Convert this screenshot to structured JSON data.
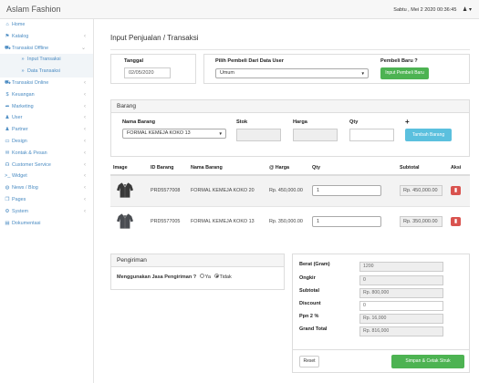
{
  "app": {
    "brand": "Aslam Fashion",
    "datetime": "Sabtu , Mei 2 2020 00:36:45",
    "user_icon": "user-icon",
    "user_caret": "▾"
  },
  "sidebar": {
    "items": [
      {
        "icon": "home-icon",
        "glyph": "⌂",
        "label": "Home",
        "chevron": ""
      },
      {
        "icon": "tag-icon",
        "glyph": "⚑",
        "label": "Katalog",
        "chevron": "‹"
      },
      {
        "icon": "cart-icon",
        "glyph": "⛟",
        "label": "Transaksi Offline",
        "chevron": "⌄"
      },
      {
        "icon": "",
        "glyph": "»",
        "label": "Input Transaksi",
        "chevron": "",
        "sub": true
      },
      {
        "icon": "",
        "glyph": "»",
        "label": "Data Transaksi",
        "chevron": "",
        "sub": true
      },
      {
        "icon": "cart-icon",
        "glyph": "⛟",
        "label": "Transaksi Online",
        "chevron": "‹"
      },
      {
        "icon": "dollar-icon",
        "glyph": "$",
        "label": "Keuangan",
        "chevron": "‹"
      },
      {
        "icon": "share-icon",
        "glyph": "➦",
        "label": "Marketing",
        "chevron": "‹"
      },
      {
        "icon": "user-icon",
        "glyph": "♟",
        "label": "User",
        "chevron": "‹"
      },
      {
        "icon": "users-icon",
        "glyph": "♟",
        "label": "Partner",
        "chevron": "‹"
      },
      {
        "icon": "desktop-icon",
        "glyph": "▭",
        "label": "Design",
        "chevron": "‹"
      },
      {
        "icon": "envelope-icon",
        "glyph": "✉",
        "label": "Kontak & Pesan",
        "chevron": "‹"
      },
      {
        "icon": "headset-icon",
        "glyph": "☊",
        "label": "Customer Service",
        "chevron": "‹"
      },
      {
        "icon": "terminal-icon",
        "glyph": ">_",
        "label": "Widget",
        "chevron": "‹"
      },
      {
        "icon": "globe-icon",
        "glyph": "◍",
        "label": "News / Blog",
        "chevron": "‹"
      },
      {
        "icon": "copy-icon",
        "glyph": "❐",
        "label": "Pages",
        "chevron": "‹"
      },
      {
        "icon": "gears-icon",
        "glyph": "⚙",
        "label": "System",
        "chevron": "‹"
      },
      {
        "icon": "book-icon",
        "glyph": "▤",
        "label": "Dokumentasi",
        "chevron": ""
      }
    ]
  },
  "page": {
    "title": "Input Penjualan / Transaksi"
  },
  "header_panel": {
    "tanggal_label": "Tanggal",
    "tanggal_value": "02/05/2020",
    "pembeli_label": "Pilih Pembeli Dari Data User",
    "pembeli_value": "Umum",
    "baru_label": "Pembeli Baru ?",
    "baru_button": "Input Pembeli Baru"
  },
  "barang_panel": {
    "title": "Barang",
    "nama_label": "Nama Barang",
    "nama_value": "FORMAL KEMEJA KOKO 13",
    "stok_label": "Stok",
    "harga_label": "Harga",
    "qty_label": "Qty",
    "plus_label": "+",
    "tambah_button": "Tambah Barang"
  },
  "table": {
    "headers": [
      "Image",
      "ID Barang",
      "Nama Barang",
      "@ Harga",
      "Qty",
      "Subtotal",
      "Aksi"
    ],
    "rows": [
      {
        "id": "PRD5577008",
        "nama": "FORMAL KEMEJA KOKO 20",
        "harga": "Rp. 450,000.00",
        "qty": "1",
        "subtotal": "Rp. 450,000.00",
        "shirt": "dark"
      },
      {
        "id": "PRD5577005",
        "nama": "FORMAL KEMEJA KOKO 13",
        "harga": "Rp. 350,000.00",
        "qty": "1",
        "subtotal": "Rp. 350,000.00",
        "shirt": "grey"
      }
    ]
  },
  "pengiriman": {
    "title": "Pengiriman",
    "question": "Menggunakan Jasa Pengiriman ?",
    "opt_ya": "Ya",
    "opt_tidak": "Tidak"
  },
  "summary": {
    "berat_label": "Berat (Gram)",
    "berat_value": "1200",
    "ongkir_label": "Ongkir",
    "ongkir_value": "0",
    "subtotal_label": "Subtotal",
    "subtotal_value": "Rp. 800,000",
    "discount_label": "Discount",
    "discount_value": "0",
    "ppn_label": "Ppn 2 %",
    "ppn_value": "Rp. 16,000",
    "grand_label": "Grand Total",
    "grand_value": "Rp. 816,000"
  },
  "actions": {
    "reset": "Reset",
    "save": "Simpan & Cetak Struk"
  },
  "colors": {
    "green": "#4db352",
    "blue": "#5bc0de",
    "red": "#d9534f",
    "link": "#4a8bc2"
  }
}
